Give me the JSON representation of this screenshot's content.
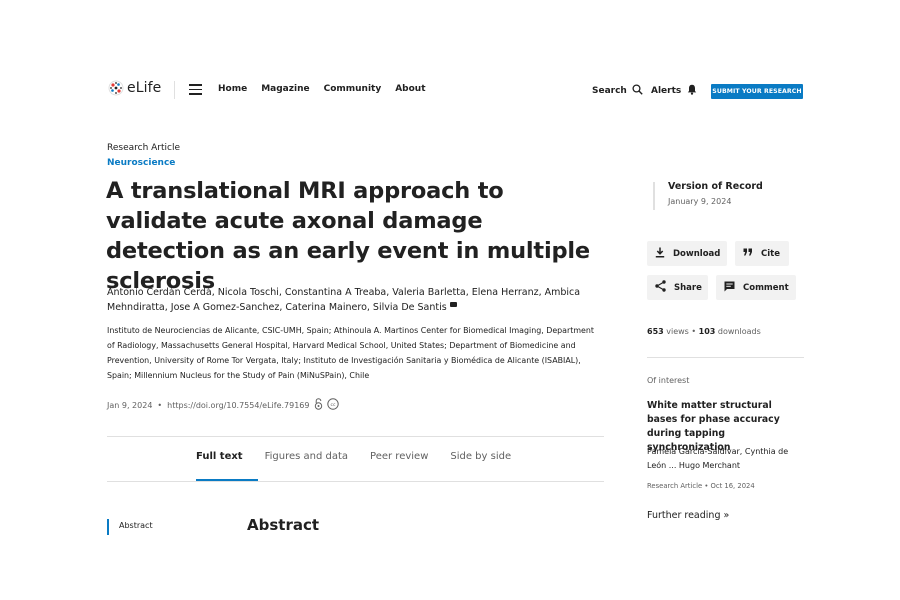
{
  "header": {
    "logo_text": "eLife",
    "nav": [
      "Home",
      "Magazine",
      "Community",
      "About"
    ],
    "search_label": "Search",
    "alerts_label": "Alerts",
    "submit_label": "SUBMIT YOUR RESEARCH",
    "accent_color": "#0a7bc4"
  },
  "article": {
    "type": "Research Article",
    "subject": "Neuroscience",
    "title": "A translational MRI approach to validate acute axonal damage detection as an early event in multiple sclerosis",
    "authors": "Antonio Cerdán Cerdá, Nicola Toschi, Constantina A Treaba, Valeria Barletta, Elena Herranz, Ambica Mehndiratta, Jose A Gomez-Sanchez, Caterina Mainero, Silvia De Santis",
    "affiliations": "Instituto de Neurociencias de Alicante, CSIC-UMH, Spain; Athinoula A. Martinos Center for Biomedical Imaging, Department of Radiology, Massachusetts General Hospital, Harvard Medical School, United States; Department of Biomedicine and Prevention, University of Rome Tor Vergata, Italy; Instituto de Investigación Sanitaria y Biomédica de Alicante (ISABIAL), Spain; Millennium Nucleus for the Study of Pain (MiNuSPain), Chile",
    "date": "Jan 9, 2024",
    "doi": "https://doi.org/10.7554/eLife.79169"
  },
  "tabs": [
    {
      "label": "Full text",
      "active": true
    },
    {
      "label": "Figures and data",
      "active": false
    },
    {
      "label": "Peer review",
      "active": false
    },
    {
      "label": "Side by side",
      "active": false
    }
  ],
  "toc": {
    "item": "Abstract"
  },
  "abstract_heading": "Abstract",
  "sidebar": {
    "vor_title": "Version of Record",
    "vor_date": "January 9, 2024",
    "buttons": {
      "download": "Download",
      "cite": "Cite",
      "share": "Share",
      "comment": "Comment"
    },
    "views": "653",
    "views_label": "views",
    "downloads": "103",
    "downloads_label": "downloads",
    "interest_label": "Of interest",
    "related": {
      "title": "White matter structural bases for phase accuracy during tapping synchronization",
      "authors": "Pamela Garcia-Saldivar, Cynthia de León ... Hugo Merchant",
      "type": "Research Article",
      "date": "Oct 16, 2024"
    },
    "further_reading": "Further reading »"
  }
}
